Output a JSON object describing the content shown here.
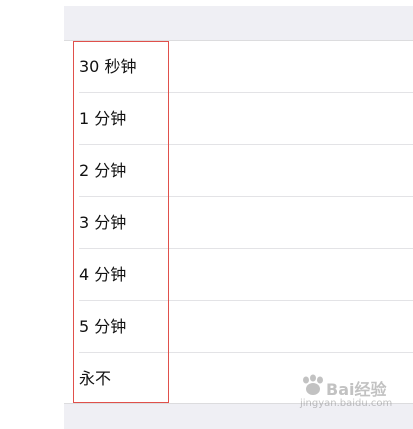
{
  "options": [
    {
      "label": "30 秒钟"
    },
    {
      "label": "1 分钟"
    },
    {
      "label": "2 分钟"
    },
    {
      "label": "3 分钟"
    },
    {
      "label": "4 分钟"
    },
    {
      "label": "5 分钟"
    },
    {
      "label": "永不"
    }
  ],
  "watermark": {
    "brand": "Bai经验",
    "url": "jingyan.baidu.com"
  },
  "colors": {
    "highlight_border": "#e0504b",
    "grouped_background": "#efeff4",
    "row_background": "#ffffff"
  }
}
